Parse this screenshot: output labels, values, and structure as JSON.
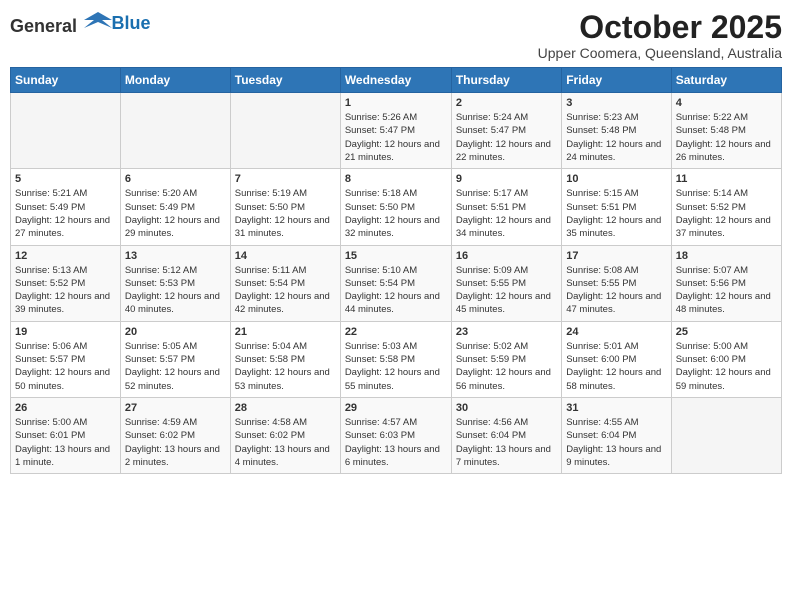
{
  "logo": {
    "text_general": "General",
    "text_blue": "Blue"
  },
  "header": {
    "month": "October 2025",
    "location": "Upper Coomera, Queensland, Australia"
  },
  "weekdays": [
    "Sunday",
    "Monday",
    "Tuesday",
    "Wednesday",
    "Thursday",
    "Friday",
    "Saturday"
  ],
  "weeks": [
    [
      {
        "day": "",
        "info": ""
      },
      {
        "day": "",
        "info": ""
      },
      {
        "day": "",
        "info": ""
      },
      {
        "day": "1",
        "info": "Sunrise: 5:26 AM\nSunset: 5:47 PM\nDaylight: 12 hours and 21 minutes."
      },
      {
        "day": "2",
        "info": "Sunrise: 5:24 AM\nSunset: 5:47 PM\nDaylight: 12 hours and 22 minutes."
      },
      {
        "day": "3",
        "info": "Sunrise: 5:23 AM\nSunset: 5:48 PM\nDaylight: 12 hours and 24 minutes."
      },
      {
        "day": "4",
        "info": "Sunrise: 5:22 AM\nSunset: 5:48 PM\nDaylight: 12 hours and 26 minutes."
      }
    ],
    [
      {
        "day": "5",
        "info": "Sunrise: 5:21 AM\nSunset: 5:49 PM\nDaylight: 12 hours and 27 minutes."
      },
      {
        "day": "6",
        "info": "Sunrise: 5:20 AM\nSunset: 5:49 PM\nDaylight: 12 hours and 29 minutes."
      },
      {
        "day": "7",
        "info": "Sunrise: 5:19 AM\nSunset: 5:50 PM\nDaylight: 12 hours and 31 minutes."
      },
      {
        "day": "8",
        "info": "Sunrise: 5:18 AM\nSunset: 5:50 PM\nDaylight: 12 hours and 32 minutes."
      },
      {
        "day": "9",
        "info": "Sunrise: 5:17 AM\nSunset: 5:51 PM\nDaylight: 12 hours and 34 minutes."
      },
      {
        "day": "10",
        "info": "Sunrise: 5:15 AM\nSunset: 5:51 PM\nDaylight: 12 hours and 35 minutes."
      },
      {
        "day": "11",
        "info": "Sunrise: 5:14 AM\nSunset: 5:52 PM\nDaylight: 12 hours and 37 minutes."
      }
    ],
    [
      {
        "day": "12",
        "info": "Sunrise: 5:13 AM\nSunset: 5:52 PM\nDaylight: 12 hours and 39 minutes."
      },
      {
        "day": "13",
        "info": "Sunrise: 5:12 AM\nSunset: 5:53 PM\nDaylight: 12 hours and 40 minutes."
      },
      {
        "day": "14",
        "info": "Sunrise: 5:11 AM\nSunset: 5:54 PM\nDaylight: 12 hours and 42 minutes."
      },
      {
        "day": "15",
        "info": "Sunrise: 5:10 AM\nSunset: 5:54 PM\nDaylight: 12 hours and 44 minutes."
      },
      {
        "day": "16",
        "info": "Sunrise: 5:09 AM\nSunset: 5:55 PM\nDaylight: 12 hours and 45 minutes."
      },
      {
        "day": "17",
        "info": "Sunrise: 5:08 AM\nSunset: 5:55 PM\nDaylight: 12 hours and 47 minutes."
      },
      {
        "day": "18",
        "info": "Sunrise: 5:07 AM\nSunset: 5:56 PM\nDaylight: 12 hours and 48 minutes."
      }
    ],
    [
      {
        "day": "19",
        "info": "Sunrise: 5:06 AM\nSunset: 5:57 PM\nDaylight: 12 hours and 50 minutes."
      },
      {
        "day": "20",
        "info": "Sunrise: 5:05 AM\nSunset: 5:57 PM\nDaylight: 12 hours and 52 minutes."
      },
      {
        "day": "21",
        "info": "Sunrise: 5:04 AM\nSunset: 5:58 PM\nDaylight: 12 hours and 53 minutes."
      },
      {
        "day": "22",
        "info": "Sunrise: 5:03 AM\nSunset: 5:58 PM\nDaylight: 12 hours and 55 minutes."
      },
      {
        "day": "23",
        "info": "Sunrise: 5:02 AM\nSunset: 5:59 PM\nDaylight: 12 hours and 56 minutes."
      },
      {
        "day": "24",
        "info": "Sunrise: 5:01 AM\nSunset: 6:00 PM\nDaylight: 12 hours and 58 minutes."
      },
      {
        "day": "25",
        "info": "Sunrise: 5:00 AM\nSunset: 6:00 PM\nDaylight: 12 hours and 59 minutes."
      }
    ],
    [
      {
        "day": "26",
        "info": "Sunrise: 5:00 AM\nSunset: 6:01 PM\nDaylight: 13 hours and 1 minute."
      },
      {
        "day": "27",
        "info": "Sunrise: 4:59 AM\nSunset: 6:02 PM\nDaylight: 13 hours and 2 minutes."
      },
      {
        "day": "28",
        "info": "Sunrise: 4:58 AM\nSunset: 6:02 PM\nDaylight: 13 hours and 4 minutes."
      },
      {
        "day": "29",
        "info": "Sunrise: 4:57 AM\nSunset: 6:03 PM\nDaylight: 13 hours and 6 minutes."
      },
      {
        "day": "30",
        "info": "Sunrise: 4:56 AM\nSunset: 6:04 PM\nDaylight: 13 hours and 7 minutes."
      },
      {
        "day": "31",
        "info": "Sunrise: 4:55 AM\nSunset: 6:04 PM\nDaylight: 13 hours and 9 minutes."
      },
      {
        "day": "",
        "info": ""
      }
    ]
  ]
}
